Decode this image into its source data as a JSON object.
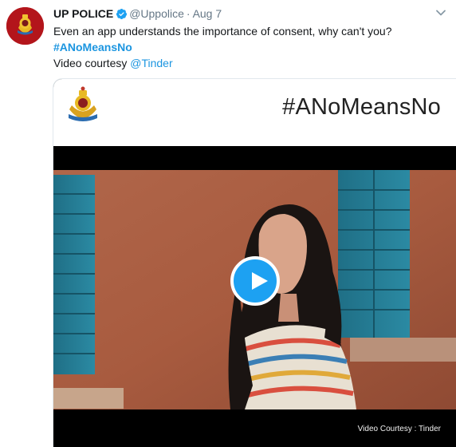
{
  "tweet": {
    "author_name": "UP POLICE",
    "handle": "@Uppolice",
    "separator": "·",
    "date": "Aug 7",
    "text_line1": "Even an app understands the importance of consent, why can't you?",
    "hashtag": "#ANoMeansNo",
    "courtesy_prefix": "Video courtesy ",
    "courtesy_mention": "@Tinder"
  },
  "media": {
    "banner_hashtag": "#ANoMeansNo",
    "video_watermark": "Video Courtesy : Tinder"
  },
  "colors": {
    "link": "#1b95e0",
    "verified": "#1da1f2",
    "avatar_bg": "#b3151b"
  },
  "icons": [
    "avatar-emblem",
    "verified-badge-icon",
    "chevron-down-icon",
    "police-emblem-icon",
    "play-icon"
  ]
}
